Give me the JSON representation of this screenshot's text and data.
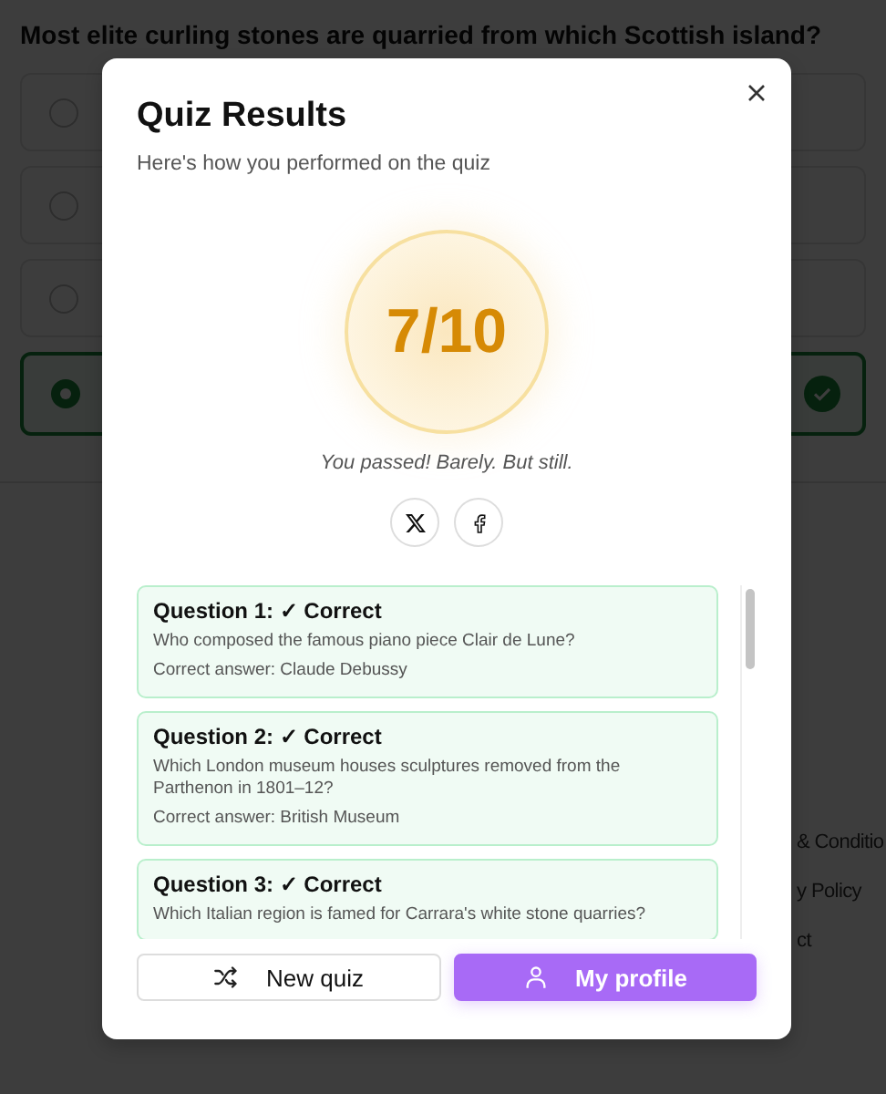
{
  "background_page": {
    "question": "Most elite curling stones are quarried from which Scottish island?",
    "options": [
      {
        "selected": false
      },
      {
        "selected": false
      },
      {
        "selected": false
      },
      {
        "selected": true
      }
    ],
    "footer_links": [
      "& Conditio",
      "y Policy",
      "ct"
    ]
  },
  "dialog": {
    "title": "Quiz Results",
    "subtitle": "Here's how you performed on the quiz",
    "score": "7/10",
    "message": "You passed! Barely. But still.",
    "share_buttons": [
      {
        "kind": "x"
      },
      {
        "kind": "facebook"
      }
    ],
    "results": [
      {
        "heading": "Question 1: ✓ Correct",
        "correct": true,
        "question": "Who composed the famous piano piece Clair de Lune?",
        "answer": "Correct answer: Claude Debussy"
      },
      {
        "heading": "Question 2: ✓ Correct",
        "correct": true,
        "question": "Which London museum houses sculptures removed from the Parthenon in 1801–12?",
        "answer": "Correct answer: British Museum"
      },
      {
        "heading": "Question 3: ✓ Correct",
        "correct": true,
        "question": "Which Italian region is famed for Carrara's white stone quarries?"
      }
    ],
    "buttons": [
      {
        "label": "New quiz",
        "kind": "secondary"
      },
      {
        "label": "My profile",
        "kind": "primary"
      }
    ]
  }
}
